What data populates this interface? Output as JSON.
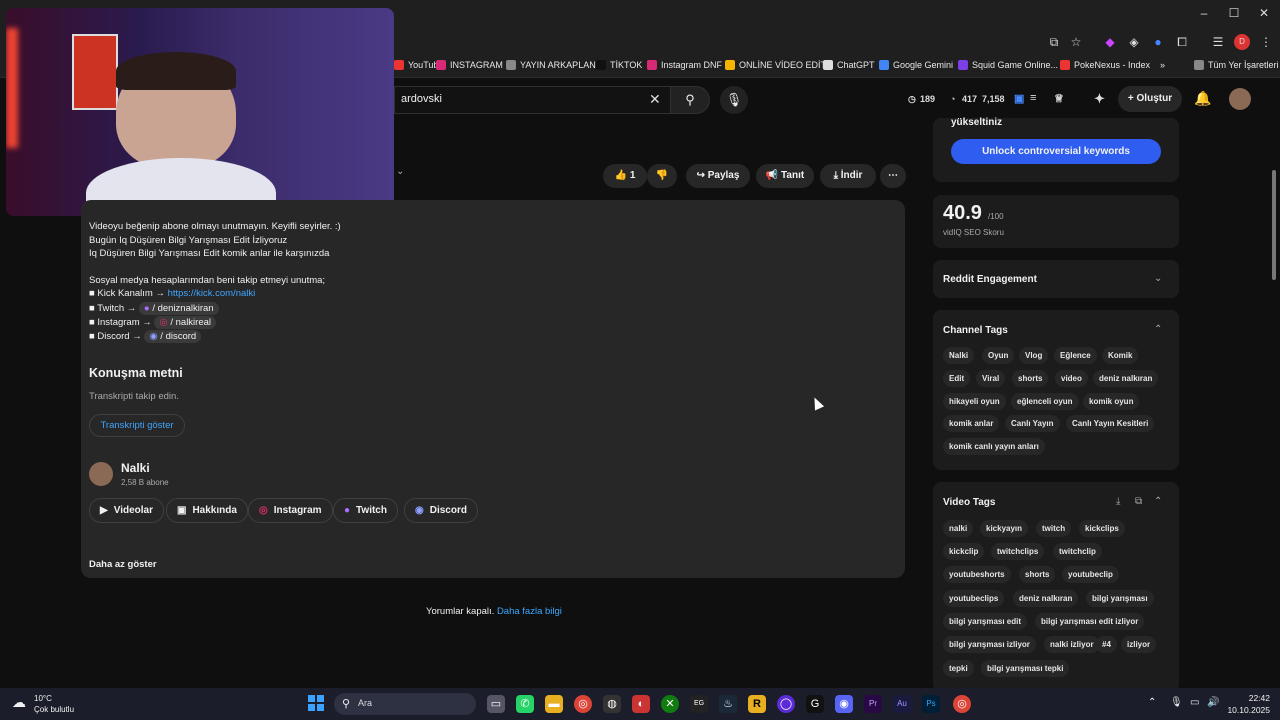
{
  "browser": {
    "search_value": "ardovski",
    "stats": [
      "189",
      "417",
      "7,158"
    ],
    "create_label": "Oluştur",
    "bookmarks": [
      {
        "label": "YouTube",
        "color": "#e33"
      },
      {
        "label": "INSTAGRAM",
        "color": "#d62976"
      },
      {
        "label": "YAYIN ARKAPLAN",
        "color": "#888"
      },
      {
        "label": "TİKTOK",
        "color": "#111"
      },
      {
        "label": "Instagram DNF",
        "color": "#d62976"
      },
      {
        "label": "ONLİNE VİDEO EDİT",
        "color": "#f4b400"
      },
      {
        "label": "ChatGPT",
        "color": "#ddd"
      },
      {
        "label": "Google Gemini",
        "color": "#4285f4"
      },
      {
        "label": "Squid Game Online...",
        "color": "#7b3fe4"
      },
      {
        "label": "PokeNexus - Index",
        "color": "#e33"
      },
      {
        "label": "Tüm Yer İşaretleri",
        "color": "#888"
      }
    ]
  },
  "actions": {
    "like_count": "1",
    "share": "Paylaş",
    "promote": "Tanıt",
    "download": "İndir"
  },
  "description": {
    "lines": [
      "Videoyu beğenip abone olmayı unutmayın. Keyifli seyirler. :)",
      "Bugün Iq Düşüren Bilgi Yarışması Edit İzliyoruz",
      "Iq Düşüren Bilgi Yarışması Edit komik anlar ile karşınızda",
      "Sosyal medya hesaplarımdan beni takip etmeyi unutma;"
    ],
    "kick_prefix": "■ Kick Kanalım → ",
    "kick_link": "https://kick.com/nalki",
    "twitch_prefix": "■ Twitch → ",
    "twitch_tag": "/ deniznalkiran",
    "instagram_prefix": "■ Instagram → ",
    "instagram_tag": "/ nalkireal",
    "discord_prefix": "■ Discord → ",
    "discord_tag": "/ discord",
    "transcript_title": "Konuşma metni",
    "transcript_sub": "Transkripti takip edin.",
    "transcript_btn": "Transkripti göster",
    "channel_name": "Nalki",
    "channel_subs": "2,58 B abone",
    "channel_buttons": [
      "Videolar",
      "Hakkında",
      "Instagram",
      "Twitch",
      "Discord"
    ],
    "show_less": "Daha az göster"
  },
  "comments": {
    "text": "Yorumlar kapalı.",
    "link": "Daha fazla bilgi"
  },
  "vidiq": {
    "upgrade_text": "yükseltiniz",
    "unlock_btn": "Unlock controversial keywords",
    "score": "40.9",
    "score_max": "/100",
    "score_label": "vidIQ SEO Skoru",
    "reddit_title": "Reddit Engagement",
    "channel_tags_title": "Channel Tags",
    "channel_tags": [
      "Nalki",
      "Oyun",
      "Vlog",
      "Eğlence",
      "Komik",
      "Edit",
      "Viral",
      "shorts",
      "video",
      "deniz nalkıran",
      "hikayeli oyun",
      "eğlenceli oyun",
      "komik oyun",
      "komik anlar",
      "Canlı Yayın",
      "Canlı Yayın Kesitleri",
      "komik canlı yayın anları"
    ],
    "video_tags_title": "Video Tags",
    "video_tags": [
      "nalki",
      "kickyayın",
      "twitch",
      "kickclips",
      "kickclip",
      "twitchclips",
      "twitchclip",
      "youtubeshorts",
      "shorts",
      "youtubeclip",
      "youtubeclips",
      "deniz nalkıran",
      "bilgi yarışması",
      "bilgi yarışması edit",
      "bilgi yarışması edit izliyor",
      "bilgi yarışması izliyor",
      "nalki izliyor",
      "#4",
      "izliyor",
      "tepki",
      "bilgi yarışması tepki"
    ]
  },
  "taskbar": {
    "weather_temp": "10°C",
    "weather_desc": "Çok bulutlu",
    "search_label": "Ara",
    "time": "22:42",
    "date": "10.10.2025"
  },
  "colors": {
    "accent_blue": "#3ea6ff",
    "vidiq_button": "#2f5df0"
  }
}
